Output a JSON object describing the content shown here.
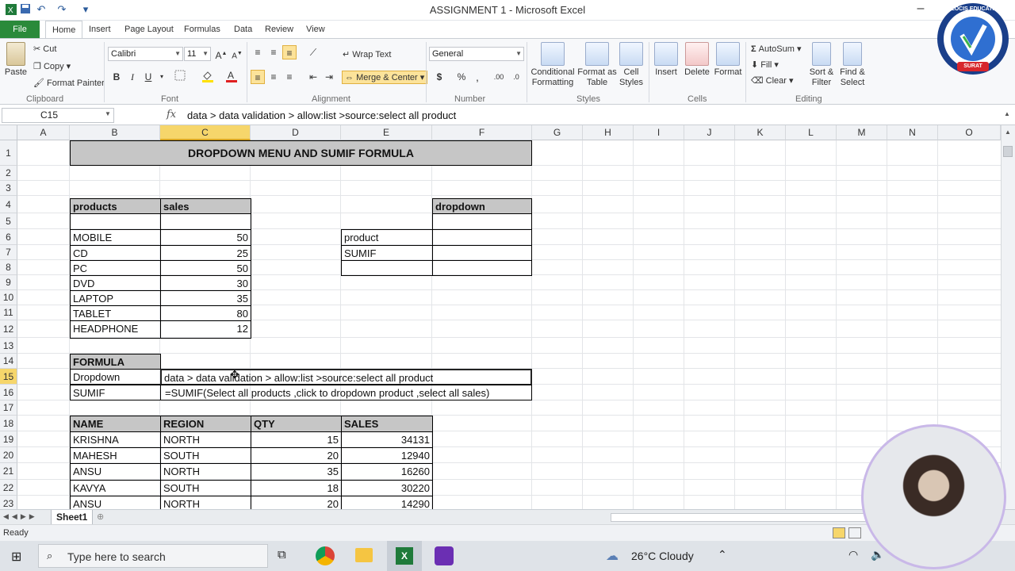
{
  "window": {
    "title": "ASSIGNMENT 1  -  Microsoft Excel"
  },
  "ribbon_tabs": [
    "File",
    "Home",
    "Insert",
    "Page Layout",
    "Formulas",
    "Data",
    "Review",
    "View"
  ],
  "clipboard": {
    "paste": "Paste",
    "cut": "Cut",
    "copy": "Copy",
    "format_painter": "Format Painter",
    "group": "Clipboard"
  },
  "font": {
    "name": "Calibri",
    "size": "11",
    "group": "Font"
  },
  "alignment": {
    "wrap": "Wrap Text",
    "merge": "Merge & Center",
    "group": "Alignment"
  },
  "number": {
    "format": "General",
    "group": "Number"
  },
  "styles": {
    "conditional": "Conditional Formatting",
    "format_table": "Format as Table",
    "cell_styles": "Cell Styles",
    "group": "Styles"
  },
  "cells": {
    "insert": "Insert",
    "delete": "Delete",
    "format": "Format",
    "group": "Cells"
  },
  "editing": {
    "autosum": "AutoSum",
    "fill": "Fill",
    "clear": "Clear",
    "sort": "Sort & Filter",
    "find": "Find & Select",
    "group": "Editing"
  },
  "logo": {
    "text": "VELOCIS EDUCATION",
    "subtext": "SURAT"
  },
  "formula_bar": {
    "name_box": "C15",
    "fx": "fx",
    "content": "data > data validation > allow:list >source:select all product"
  },
  "columns": [
    "A",
    "B",
    "C",
    "D",
    "E",
    "F",
    "G",
    "H",
    "I",
    "J",
    "K",
    "L",
    "M",
    "N",
    "O"
  ],
  "rows": [
    "1",
    "2",
    "3",
    "4",
    "5",
    "6",
    "7",
    "8",
    "9",
    "10",
    "11",
    "12",
    "13",
    "14",
    "15",
    "16",
    "17",
    "18",
    "19",
    "20",
    "21",
    "22",
    "23"
  ],
  "sheet": {
    "title": "DROPDOWN MENU AND SUMIF FORMULA",
    "products_header": "products",
    "sales_header": "sales",
    "products": [
      {
        "name": "MOBILE",
        "sales": "50"
      },
      {
        "name": "CD",
        "sales": "25"
      },
      {
        "name": "PC",
        "sales": "50"
      },
      {
        "name": "DVD",
        "sales": "30"
      },
      {
        "name": "LAPTOP",
        "sales": "35"
      },
      {
        "name": "TABLET",
        "sales": "80"
      },
      {
        "name": "HEADPHONE",
        "sales": "12"
      }
    ],
    "dropdown_header": "dropdown",
    "product_label": "product",
    "sumif_label": "SUMIF",
    "formula_header": "FORMULA",
    "formula_dropdown_label": "Dropdown",
    "formula_dropdown_text": "data > data validation > allow:list >source:select all product",
    "formula_sumif_label": "SUMIF",
    "formula_sumif_text": "=SUMIF(Select all products ,click to dropdown product ,select all sales)",
    "table2_headers": [
      "NAME",
      "REGION",
      "QTY",
      "SALES"
    ],
    "table2": [
      [
        "KRISHNA",
        "NORTH",
        "15",
        "34131"
      ],
      [
        "MAHESH",
        "SOUTH",
        "20",
        "12940"
      ],
      [
        "ANSU",
        "NORTH",
        "35",
        "16260"
      ],
      [
        "KAVYA",
        "SOUTH",
        "18",
        "30220"
      ],
      [
        "ANSU",
        "NORTH",
        "20",
        "14290"
      ]
    ]
  },
  "sheet_tab": "Sheet1",
  "status": "Ready",
  "taskbar": {
    "search": "Type here to search",
    "weather": "26°C  Cloudy"
  },
  "colors": {
    "file_tab": "#2a8a3a",
    "selected_header": "#f6d66b",
    "header_fill": "#c6c6c6"
  }
}
